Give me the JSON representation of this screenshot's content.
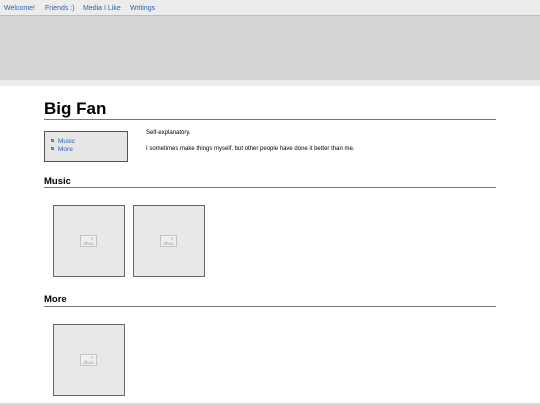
{
  "nav": {
    "items": [
      {
        "label": "Welcome!"
      },
      {
        "label": "Friends :)"
      },
      {
        "label": "Media I Like"
      },
      {
        "label": "Writings"
      }
    ]
  },
  "page": {
    "title": "Big Fan",
    "toc": [
      "Music",
      "More"
    ],
    "intro_lines": [
      "Self-explanatory.",
      "I sometimes make things myself, but other people have done it better than me."
    ]
  },
  "sections": [
    {
      "heading": "Music",
      "tiles": [
        "image-placeholder-icon",
        "image-placeholder-icon"
      ]
    },
    {
      "heading": "More",
      "tiles": [
        "image-placeholder-icon"
      ]
    }
  ],
  "colors": {
    "link": "#2a63b8",
    "banner": "#d5d5d5",
    "tile": "#e8e8e8"
  }
}
